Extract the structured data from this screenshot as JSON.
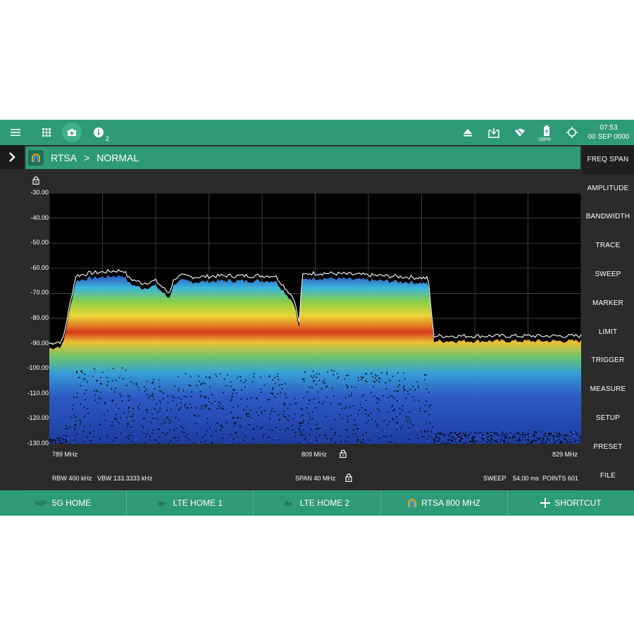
{
  "topbar": {
    "info_count": "2",
    "battery": "100%",
    "time": "07:53",
    "date": "00 SEP 0000",
    "icons": [
      "menu-icon",
      "apps-grid-icon",
      "camera-icon",
      "info-icon",
      "eject-icon",
      "download-icon",
      "wifi-off-icon",
      "battery-icon",
      "gps-icon"
    ]
  },
  "mode": {
    "name": "RTSA",
    "separator": ">",
    "submode": "NORMAL"
  },
  "right_menu": [
    "FREQ SPAN",
    "AMPLITUDE",
    "BANDWIDTH",
    "TRACE",
    "SWEEP",
    "MARKER",
    "LIMIT",
    "TRIGGER",
    "MEASURE",
    "SETUP",
    "PRESET",
    "FILE"
  ],
  "plot": {
    "y_ticks": [
      "-30.00",
      "-40.00",
      "-50.00",
      "-60.00",
      "-70.00",
      "-80.00",
      "-90.00",
      "-100.00",
      "-110.00",
      "-120.00",
      "-130.00"
    ],
    "start_freq": "789 MHz",
    "center_freq": "809 MHz",
    "stop_freq": "829 MHz",
    "rbw": "RBW 400 kHz",
    "vbw": "VBW 133.3333 kHz",
    "span": "SPAN 40 MHz",
    "sweep_label": "SWEEP",
    "sweep_time": "54.00 ms",
    "points": "POINTS 601"
  },
  "chart_data": {
    "type": "line",
    "x_unit": "MHz",
    "x": [
      789,
      790,
      790.6,
      791,
      792,
      793,
      794,
      794.6,
      795,
      796,
      797,
      798,
      798.4,
      799,
      800,
      802,
      804,
      806,
      808,
      807.4,
      807.8,
      808.5,
      810,
      812,
      814,
      816,
      817.5,
      817.9,
      818.3,
      820,
      822,
      824,
      826,
      829
    ],
    "x_sorted_note": "",
    "max_hold": [
      -90,
      -89,
      -73,
      -63,
      -62,
      -61.5,
      -61,
      -61,
      -64,
      -66,
      -65,
      -70,
      -64,
      -63,
      -63.5,
      -63,
      -63,
      -63,
      -63,
      -72,
      -82,
      -62,
      -62,
      -62.5,
      -63,
      -63.5,
      -64,
      -87,
      -87,
      -87,
      -87,
      -87,
      -87,
      -87
    ],
    "ylim": [
      -130,
      -30
    ],
    "xlim": [
      789,
      829
    ]
  },
  "colors": {
    "accent": "#2f9a77",
    "background": "#2b2b2b",
    "plot_bg": "#000000",
    "trace": "#ffffff"
  },
  "bottom_tabs": [
    {
      "label": "5G HOME",
      "icon": "5g-icon"
    },
    {
      "label": "LTE HOME 1",
      "icon": "lte-icon"
    },
    {
      "label": "LTE HOME 2",
      "icon": "lte-icon"
    },
    {
      "label": "RTSA 800 MHZ",
      "icon": "rtsa-icon"
    },
    {
      "label": "SHORTCUT",
      "icon": "plus-icon"
    }
  ]
}
